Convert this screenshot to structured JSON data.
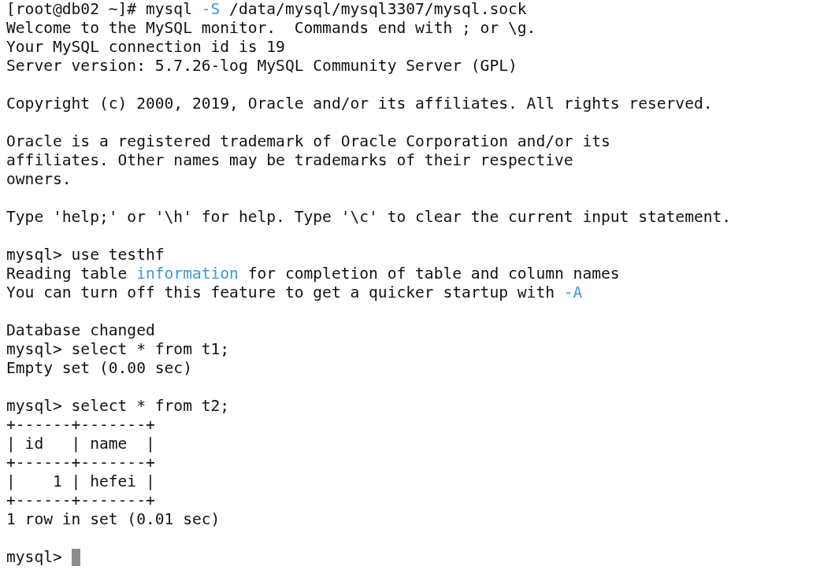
{
  "terminal": {
    "lines": [
      {
        "kind": "text",
        "segments": [
          {
            "text": "[root@db02 ~]# mysql "
          },
          {
            "text": "-S",
            "color": "#3a9bd9"
          },
          {
            "text": " /data/mysql/mysql3307/mysql.sock"
          }
        ]
      },
      {
        "kind": "text",
        "segments": [
          {
            "text": "Welcome to the MySQL monitor.  Commands end with ; or \\g."
          }
        ]
      },
      {
        "kind": "text",
        "segments": [
          {
            "text": "Your MySQL connection id is 19"
          }
        ]
      },
      {
        "kind": "text",
        "segments": [
          {
            "text": "Server version: 5.7.26-log MySQL Community Server (GPL)"
          }
        ]
      },
      {
        "kind": "blank"
      },
      {
        "kind": "text",
        "segments": [
          {
            "text": "Copyright (c) 2000, 2019, Oracle and/or its affiliates. All rights reserved."
          }
        ]
      },
      {
        "kind": "blank"
      },
      {
        "kind": "text",
        "segments": [
          {
            "text": "Oracle is a registered trademark of Oracle Corporation and/or its"
          }
        ]
      },
      {
        "kind": "text",
        "segments": [
          {
            "text": "affiliates. Other names may be trademarks of their respective"
          }
        ]
      },
      {
        "kind": "text",
        "segments": [
          {
            "text": "owners."
          }
        ]
      },
      {
        "kind": "blank"
      },
      {
        "kind": "text",
        "segments": [
          {
            "text": "Type 'help;' or '\\h' for help. Type '\\c' to clear the current input statement."
          }
        ]
      },
      {
        "kind": "blank"
      },
      {
        "kind": "text",
        "segments": [
          {
            "text": "mysql> use testhf"
          }
        ]
      },
      {
        "kind": "text",
        "segments": [
          {
            "text": "Reading table "
          },
          {
            "text": "information",
            "color": "#3a9bd9"
          },
          {
            "text": " for completion of table and column names"
          }
        ]
      },
      {
        "kind": "text",
        "segments": [
          {
            "text": "You can turn off this feature to get a quicker startup with "
          },
          {
            "text": "-A",
            "color": "#3a9bd9"
          }
        ]
      },
      {
        "kind": "blank"
      },
      {
        "kind": "text",
        "segments": [
          {
            "text": "Database changed"
          }
        ]
      },
      {
        "kind": "text",
        "segments": [
          {
            "text": "mysql> select * from t1;"
          }
        ]
      },
      {
        "kind": "text",
        "segments": [
          {
            "text": "Empty set (0.00 sec)"
          }
        ]
      },
      {
        "kind": "blank"
      },
      {
        "kind": "text",
        "segments": [
          {
            "text": "mysql> select * from t2;"
          }
        ]
      },
      {
        "kind": "text",
        "segments": [
          {
            "text": "+------+-------+"
          }
        ]
      },
      {
        "kind": "text",
        "segments": [
          {
            "text": "| id   | name  |"
          }
        ]
      },
      {
        "kind": "text",
        "segments": [
          {
            "text": "+------+-------+"
          }
        ]
      },
      {
        "kind": "text",
        "segments": [
          {
            "text": "|    1 | hefei |"
          }
        ]
      },
      {
        "kind": "text",
        "segments": [
          {
            "text": "+------+-------+"
          }
        ]
      },
      {
        "kind": "text",
        "segments": [
          {
            "text": "1 row in set (0.01 sec)"
          }
        ]
      },
      {
        "kind": "blank"
      },
      {
        "kind": "prompt",
        "segments": [
          {
            "text": "mysql>"
          }
        ],
        "cursor": true
      }
    ]
  }
}
